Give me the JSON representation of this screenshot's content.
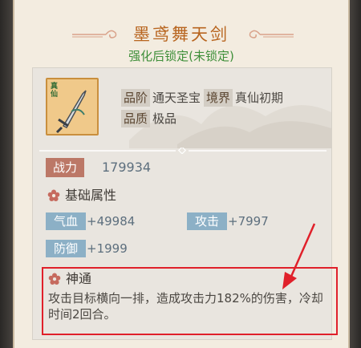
{
  "item": {
    "name": "墨鸢舞天剑",
    "lock_status": "强化后锁定(未锁定)",
    "icon_tag": "真仙",
    "grade_label": "品阶",
    "grade_value": "通天圣宝",
    "realm_label": "境界",
    "realm_value": "真仙初期",
    "quality_label": "品质",
    "quality_value": "极品"
  },
  "power": {
    "label": "战力",
    "value": "179934"
  },
  "base_attributes": {
    "title": "基础属性",
    "stats": [
      {
        "label": "气血",
        "value": "+49984"
      },
      {
        "label": "攻击",
        "value": "+7997"
      },
      {
        "label": "防御",
        "value": "+1999"
      }
    ]
  },
  "skill": {
    "title": "神通",
    "description": "攻击目标横向一排，造成攻击力182%的伤害，冷却时间2回合。"
  },
  "colors": {
    "title": "#b8651f",
    "lock_status": "#3f8f3a",
    "power_badge": "#bc7867",
    "stat_badge": "#8cb0c6",
    "highlight_box": "#e0202a"
  },
  "icons": {
    "sword": "sword-icon",
    "flower": "flower-bullet-icon",
    "ornament": "cloud-ornament-icon"
  }
}
